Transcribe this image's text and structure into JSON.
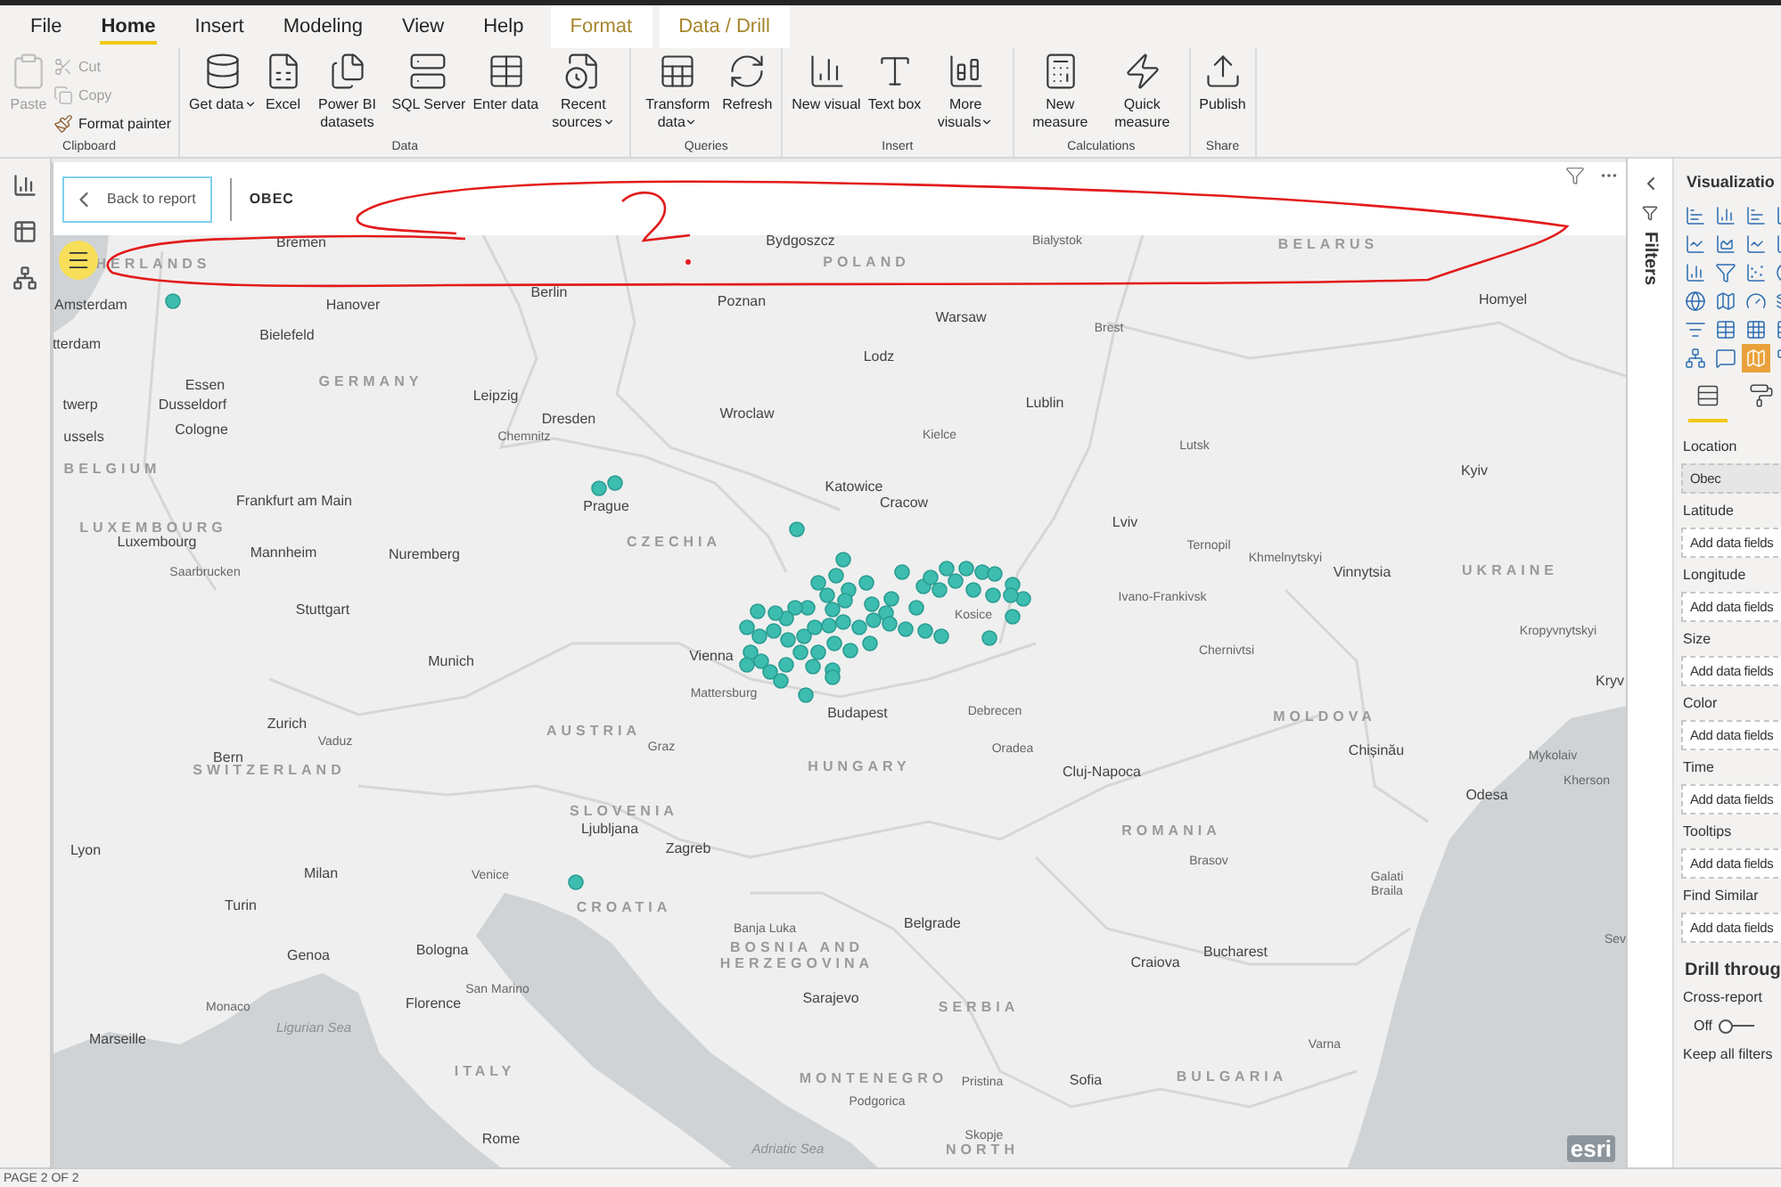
{
  "ribbon": {
    "tabs": [
      {
        "label": "File",
        "selected": false,
        "kind": "standard"
      },
      {
        "label": "Home",
        "selected": true,
        "kind": "standard"
      },
      {
        "label": "Insert",
        "selected": false,
        "kind": "standard"
      },
      {
        "label": "Modeling",
        "selected": false,
        "kind": "standard"
      },
      {
        "label": "View",
        "selected": false,
        "kind": "standard"
      },
      {
        "label": "Help",
        "selected": false,
        "kind": "standard"
      },
      {
        "label": "Format",
        "selected": false,
        "kind": "contextual"
      },
      {
        "label": "Data / Drill",
        "selected": false,
        "kind": "contextual"
      }
    ],
    "groups": [
      {
        "label": "Clipboard",
        "buttons": [
          {
            "label": "Paste",
            "kind": "large",
            "disabled": true,
            "dropdown": false
          },
          {
            "label": "Cut",
            "kind": "small",
            "disabled": true,
            "dropdown": false
          },
          {
            "label": "Copy",
            "kind": "small",
            "disabled": true,
            "dropdown": false
          },
          {
            "label": "Format painter",
            "kind": "small",
            "disabled": false,
            "dropdown": false
          }
        ]
      },
      {
        "label": "Data",
        "buttons": [
          {
            "label": "Get data",
            "kind": "large",
            "disabled": false,
            "dropdown": true
          },
          {
            "label": "Excel",
            "kind": "large",
            "disabled": false,
            "dropdown": false
          },
          {
            "label": "Power BI datasets",
            "kind": "large",
            "disabled": false,
            "dropdown": false
          },
          {
            "label": "SQL Server",
            "kind": "large",
            "disabled": false,
            "dropdown": false
          },
          {
            "label": "Enter data",
            "kind": "large",
            "disabled": false,
            "dropdown": false
          },
          {
            "label": "Recent sources",
            "kind": "large",
            "disabled": false,
            "dropdown": true
          }
        ]
      },
      {
        "label": "Queries",
        "buttons": [
          {
            "label": "Transform data",
            "kind": "large",
            "disabled": false,
            "dropdown": true
          },
          {
            "label": "Refresh",
            "kind": "large",
            "disabled": false,
            "dropdown": false
          }
        ]
      },
      {
        "label": "Insert",
        "buttons": [
          {
            "label": "New visual",
            "kind": "large",
            "disabled": false,
            "dropdown": false
          },
          {
            "label": "Text box",
            "kind": "large",
            "disabled": false,
            "dropdown": false
          },
          {
            "label": "More visuals",
            "kind": "large",
            "disabled": false,
            "dropdown": true
          }
        ]
      },
      {
        "label": "Calculations",
        "buttons": [
          {
            "label": "New measure",
            "kind": "large",
            "disabled": false,
            "dropdown": false
          },
          {
            "label": "Quick measure",
            "kind": "large",
            "disabled": false,
            "dropdown": false
          }
        ]
      },
      {
        "label": "Share",
        "buttons": [
          {
            "label": "Publish",
            "kind": "large",
            "disabled": false,
            "dropdown": false
          }
        ]
      }
    ]
  },
  "canvas": {
    "back_button": "Back to report",
    "title": "OBEC"
  },
  "map": {
    "labels": [
      {
        "text": "HERLANDS",
        "kind": "country"
      },
      {
        "text": "GERMANY",
        "kind": "country"
      },
      {
        "text": "POLAND",
        "kind": "country"
      },
      {
        "text": "BELARUS",
        "kind": "country"
      },
      {
        "text": "BELGIUM",
        "kind": "country"
      },
      {
        "text": "LUXEMBOURG",
        "kind": "country"
      },
      {
        "text": "CZECHIA",
        "kind": "country"
      },
      {
        "text": "AUSTRIA",
        "kind": "country"
      },
      {
        "text": "SWITZERLAND",
        "kind": "country"
      },
      {
        "text": "HUNGARY",
        "kind": "country"
      },
      {
        "text": "SLOVENIA",
        "kind": "country"
      },
      {
        "text": "CROATIA",
        "kind": "country"
      },
      {
        "text": "BOSNIA AND HERZEGOVINA",
        "kind": "country"
      },
      {
        "text": "SERBIA",
        "kind": "country"
      },
      {
        "text": "ROMANIA",
        "kind": "country"
      },
      {
        "text": "MOLDOVA",
        "kind": "country"
      },
      {
        "text": "UKRAINE",
        "kind": "country"
      },
      {
        "text": "BULGARIA",
        "kind": "country"
      },
      {
        "text": "ITALY",
        "kind": "country"
      },
      {
        "text": "MONTENEGRO",
        "kind": "country"
      },
      {
        "text": "NORTH",
        "kind": "country"
      },
      {
        "text": "Bremen",
        "kind": "city"
      },
      {
        "text": "Bydgoszcz",
        "kind": "city"
      },
      {
        "text": "Bialystok",
        "kind": "town"
      },
      {
        "text": "Amsterdam",
        "kind": "city"
      },
      {
        "text": "Hanover",
        "kind": "city"
      },
      {
        "text": "Berlin",
        "kind": "city"
      },
      {
        "text": "Poznan",
        "kind": "city"
      },
      {
        "text": "Warsaw",
        "kind": "city"
      },
      {
        "text": "Brest",
        "kind": "town"
      },
      {
        "text": "Homyel",
        "kind": "city"
      },
      {
        "text": "tterdam",
        "kind": "city"
      },
      {
        "text": "Bielefeld",
        "kind": "city"
      },
      {
        "text": "Lodz",
        "kind": "city"
      },
      {
        "text": "Essen",
        "kind": "city"
      },
      {
        "text": "Dusseldorf",
        "kind": "city"
      },
      {
        "text": "Cologne",
        "kind": "city"
      },
      {
        "text": "Leipzig",
        "kind": "city"
      },
      {
        "text": "Dresden",
        "kind": "city"
      },
      {
        "text": "Chemnitz",
        "kind": "town"
      },
      {
        "text": "Wroclaw",
        "kind": "city"
      },
      {
        "text": "Kielce",
        "kind": "town"
      },
      {
        "text": "Lublin",
        "kind": "city"
      },
      {
        "text": "Lutsk",
        "kind": "town"
      },
      {
        "text": "Kyiv",
        "kind": "city"
      },
      {
        "text": "twerp",
        "kind": "city"
      },
      {
        "text": "ussels",
        "kind": "city"
      },
      {
        "text": "Frankfurt am Main",
        "kind": "city"
      },
      {
        "text": "Prague",
        "kind": "city"
      },
      {
        "text": "Katowice",
        "kind": "city"
      },
      {
        "text": "Cracow",
        "kind": "city"
      },
      {
        "text": "Lviv",
        "kind": "city"
      },
      {
        "text": "Ternopil",
        "kind": "town"
      },
      {
        "text": "Khmelnytskyi",
        "kind": "town"
      },
      {
        "text": "Vinnytsia",
        "kind": "city"
      },
      {
        "text": "Ivano-Frankivsk",
        "kind": "town"
      },
      {
        "text": "Kosice",
        "kind": "town"
      },
      {
        "text": "Kropyvnytskyi",
        "kind": "town"
      },
      {
        "text": "Chernivtsi",
        "kind": "town"
      },
      {
        "text": "Luxembourg",
        "kind": "city"
      },
      {
        "text": "Mannheim",
        "kind": "city"
      },
      {
        "text": "Nuremberg",
        "kind": "city"
      },
      {
        "text": "Saarbrucken",
        "kind": "town"
      },
      {
        "text": "Stuttgart",
        "kind": "city"
      },
      {
        "text": "Munich",
        "kind": "city"
      },
      {
        "text": "Vienna",
        "kind": "city"
      },
      {
        "text": "Mattersburg",
        "kind": "town"
      },
      {
        "text": "Budapest",
        "kind": "city"
      },
      {
        "text": "Debrecen",
        "kind": "town"
      },
      {
        "text": "Kryv",
        "kind": "city"
      },
      {
        "text": "Zurich",
        "kind": "city"
      },
      {
        "text": "Vaduz",
        "kind": "town"
      },
      {
        "text": "Bern",
        "kind": "city"
      },
      {
        "text": "Graz",
        "kind": "town"
      },
      {
        "text": "Oradea",
        "kind": "town"
      },
      {
        "text": "Cluj-Napoca",
        "kind": "city"
      },
      {
        "text": "Chișinău",
        "kind": "city"
      },
      {
        "text": "Mykolaiv",
        "kind": "town"
      },
      {
        "text": "Kherson",
        "kind": "town"
      },
      {
        "text": "Odesa",
        "kind": "city"
      },
      {
        "text": "Lyon",
        "kind": "city"
      },
      {
        "text": "Ljubljana",
        "kind": "city"
      },
      {
        "text": "Zagreb",
        "kind": "city"
      },
      {
        "text": "Milan",
        "kind": "city"
      },
      {
        "text": "Venice",
        "kind": "town"
      },
      {
        "text": "Brasov",
        "kind": "town"
      },
      {
        "text": "Galati",
        "kind": "town"
      },
      {
        "text": "Braila",
        "kind": "town"
      },
      {
        "text": "Turin",
        "kind": "city"
      },
      {
        "text": "Banja Luka",
        "kind": "town"
      },
      {
        "text": "Belgrade",
        "kind": "city"
      },
      {
        "text": "Craiova",
        "kind": "city"
      },
      {
        "text": "Bucharest",
        "kind": "city"
      },
      {
        "text": "Sev",
        "kind": "town"
      },
      {
        "text": "Genoa",
        "kind": "city"
      },
      {
        "text": "Bologna",
        "kind": "city"
      },
      {
        "text": "San Marino",
        "kind": "town"
      },
      {
        "text": "Florence",
        "kind": "city"
      },
      {
        "text": "Sarajevo",
        "kind": "city"
      },
      {
        "text": "Monaco",
        "kind": "town"
      },
      {
        "text": "Marseille",
        "kind": "city"
      },
      {
        "text": "Varna",
        "kind": "town"
      },
      {
        "text": "Pristina",
        "kind": "town"
      },
      {
        "text": "Sofia",
        "kind": "city"
      },
      {
        "text": "Podgorica",
        "kind": "town"
      },
      {
        "text": "Skopje",
        "kind": "town"
      },
      {
        "text": "Rome",
        "kind": "city"
      },
      {
        "text": "Ligurian Sea",
        "kind": "sea"
      },
      {
        "text": "Adriatic Sea",
        "kind": "sea"
      }
    ],
    "attribution": "esri"
  },
  "filters_pane": {
    "title": "Filters"
  },
  "visualizations": {
    "title": "Visualizatio",
    "visuals": [
      {
        "selected": false
      },
      {
        "selected": false
      },
      {
        "selected": false
      },
      {
        "selected": false
      },
      {
        "selected": false
      },
      {
        "selected": false
      },
      {
        "selected": false
      },
      {
        "selected": false
      },
      {
        "selected": false
      },
      {
        "selected": false
      },
      {
        "selected": false
      },
      {
        "selected": false
      },
      {
        "selected": false
      },
      {
        "selected": false
      },
      {
        "selected": false
      },
      {
        "selected": false
      },
      {
        "selected": false
      },
      {
        "selected": false
      },
      {
        "selected": false
      },
      {
        "selected": false
      },
      {
        "selected": false
      },
      {
        "selected": false
      },
      {
        "selected": true
      },
      {
        "selected": false
      }
    ],
    "pane_tabs": [
      {
        "selected": true
      },
      {
        "selected": false
      }
    ],
    "wells": [
      {
        "label": "Location",
        "value": "Obec"
      },
      {
        "label": "Latitude",
        "placeholder": "Add data fields"
      },
      {
        "label": "Longitude",
        "placeholder": "Add data fields"
      },
      {
        "label": "Size",
        "placeholder": "Add data fields"
      },
      {
        "label": "Color",
        "placeholder": "Add data fields"
      },
      {
        "label": "Time",
        "placeholder": "Add data fields"
      },
      {
        "label": "Tooltips",
        "placeholder": "Add data fields"
      },
      {
        "label": "Find Similar",
        "placeholder": "Add data fields"
      }
    ],
    "drill_through": {
      "title": "Drill throug",
      "cross_report": {
        "label": "Cross-report",
        "state_label": "Off",
        "on": false
      },
      "keep_all_filters": {
        "label": "Keep all filters"
      }
    }
  },
  "status_bar": {
    "page": "PAGE 2 OF 2"
  }
}
